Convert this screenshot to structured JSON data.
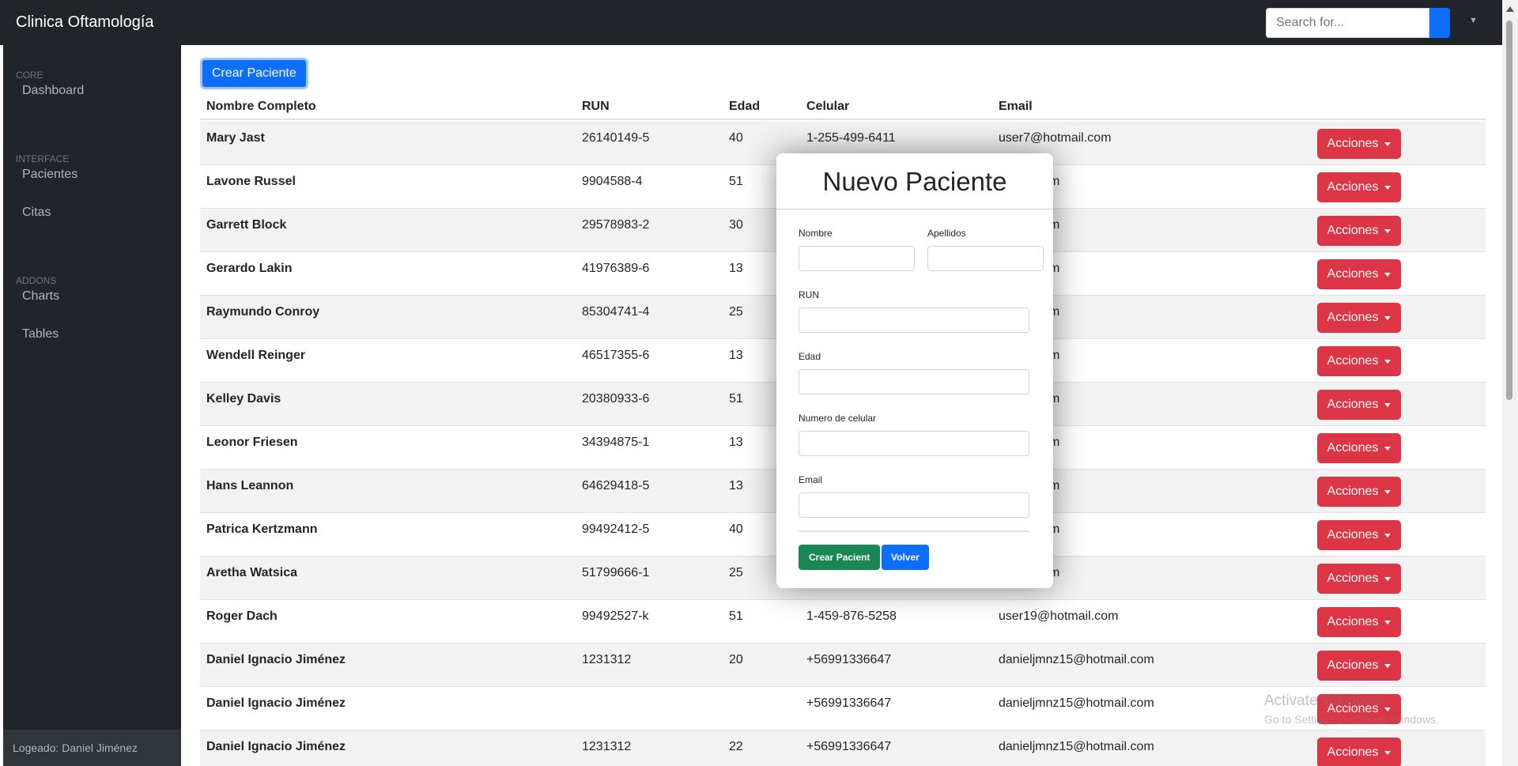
{
  "app": {
    "brand": "Clinica Oftamología"
  },
  "search": {
    "placeholder": "Search for..."
  },
  "sidebar": {
    "sections": [
      {
        "heading": "CORE",
        "items": [
          "Dashboard"
        ]
      },
      {
        "heading": "INTERFACE",
        "items": [
          "Pacientes",
          "Citas"
        ]
      },
      {
        "heading": "ADDONS",
        "items": [
          "Charts",
          "Tables"
        ]
      }
    ],
    "footer": "Logeado: Daniel Jiménez"
  },
  "main": {
    "create_button": "Crear Paciente",
    "columns": [
      "Nombre Completo",
      "RUN",
      "Edad",
      "Celular",
      "Email"
    ],
    "action_label": "Acciones",
    "rows": [
      {
        "name": "Mary Jast",
        "run": "26140149-5",
        "edad": "40",
        "celular": "1-255-499-6411",
        "email": "user7@hotmail.com"
      },
      {
        "name": "Lavone Russel",
        "run": "9904588-4",
        "edad": "51",
        "celular": "",
        "email": "otmail.com"
      },
      {
        "name": "Garrett Block",
        "run": "29578983-2",
        "edad": "30",
        "celular": "",
        "email": "otmail.com"
      },
      {
        "name": "Gerardo Lakin",
        "run": "41976389-6",
        "edad": "13",
        "celular": "",
        "email": "otmail.com"
      },
      {
        "name": "Raymundo Conroy",
        "run": "85304741-4",
        "edad": "25",
        "celular": "",
        "email": "otmail.com"
      },
      {
        "name": "Wendell Reinger",
        "run": "46517355-6",
        "edad": "13",
        "celular": "",
        "email": "otmail.com"
      },
      {
        "name": "Kelley Davis",
        "run": "20380933-6",
        "edad": "51",
        "celular": "",
        "email": "otmail.com"
      },
      {
        "name": "Leonor Friesen",
        "run": "34394875-1",
        "edad": "13",
        "celular": "",
        "email": "otmail.com"
      },
      {
        "name": "Hans Leannon",
        "run": "64629418-5",
        "edad": "13",
        "celular": "",
        "email": "otmail.com"
      },
      {
        "name": "Patrica Kertzmann",
        "run": "99492412-5",
        "edad": "40",
        "celular": "",
        "email": "otmail.com"
      },
      {
        "name": "Aretha Watsica",
        "run": "51799666-1",
        "edad": "25",
        "celular": "",
        "email": "otmail.com"
      },
      {
        "name": "Roger Dach",
        "run": "99492527-k",
        "edad": "51",
        "celular": "1-459-876-5258",
        "email": "user19@hotmail.com"
      },
      {
        "name": "Daniel Ignacio Jiménez",
        "run": "1231312",
        "edad": "20",
        "celular": "+56991336647",
        "email": "danieljmnz15@hotmail.com"
      },
      {
        "name": "Daniel Ignacio Jiménez",
        "run": "",
        "edad": "",
        "celular": "+56991336647",
        "email": "danieljmnz15@hotmail.com"
      },
      {
        "name": "Daniel Ignacio Jiménez",
        "run": "1231312",
        "edad": "22",
        "celular": "+56991336647",
        "email": "danieljmnz15@hotmail.com"
      }
    ]
  },
  "modal": {
    "title": "Nuevo Paciente",
    "labels": {
      "nombre": "Nombre",
      "apellidos": "Apellidos",
      "run": "RUN",
      "edad": "Edad",
      "celular": "Numero de celular",
      "email": "Email"
    },
    "submit": "Crear Pacient",
    "back": "Volver"
  },
  "watermark": {
    "title": "Activate Windows",
    "subtitle": "Go to Settings to activate Windows."
  },
  "colors": {
    "navbar": "#212529",
    "primary": "#0d6efd",
    "danger": "#dc3545",
    "success": "#198754"
  }
}
